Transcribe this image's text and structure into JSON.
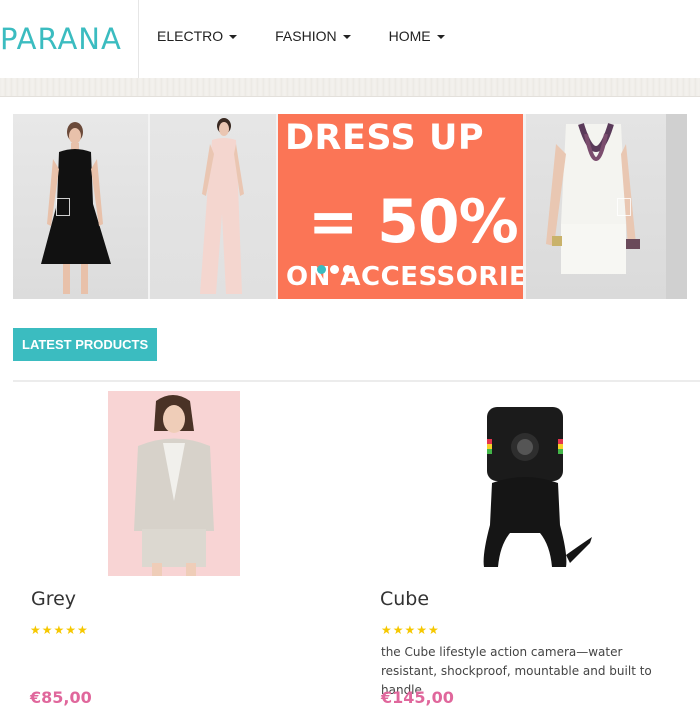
{
  "header": {
    "logo": "PARANA",
    "nav": [
      {
        "label": "ELECTRO"
      },
      {
        "label": "FASHION"
      },
      {
        "label": "HOME"
      }
    ]
  },
  "banner": {
    "promo_line1": "DRESS UP",
    "promo_line2": "= 50%",
    "promo_line3": "ON ACCESSORIES",
    "accent_color": "#fb7556",
    "slide_count": 3,
    "active_slide": 1
  },
  "latest": {
    "title": "LATEST PRODUCTS",
    "products": [
      {
        "name": "Grey",
        "rating": "★★★★★",
        "description": "",
        "price": "€85,00"
      },
      {
        "name": "Cube",
        "rating": "★★★★★",
        "description": "the Cube lifestyle action camera—water resistant, shockproof, mountable and built to handle",
        "price": "€145,00"
      }
    ]
  },
  "colors": {
    "brand": "#3bbcc0",
    "price": "#e0679c",
    "star": "#f6c800"
  }
}
